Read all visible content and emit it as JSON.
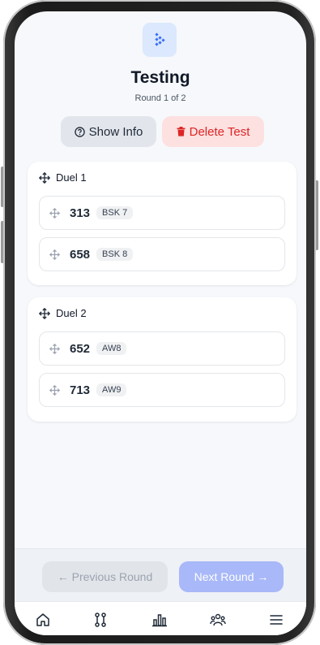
{
  "header": {
    "title": "Testing",
    "subtitle": "Round 1 of 2",
    "logo_icon": "app-logo-icon"
  },
  "actions": {
    "show_info": {
      "label": "Show Info",
      "icon": "help-circle-icon"
    },
    "delete_test": {
      "label": "Delete Test",
      "icon": "trash-icon"
    }
  },
  "duels": [
    {
      "title": "Duel 1",
      "entries": [
        {
          "number": "313",
          "tag": "BSK 7"
        },
        {
          "number": "658",
          "tag": "BSK 8"
        }
      ]
    },
    {
      "title": "Duel 2",
      "entries": [
        {
          "number": "652",
          "tag": "AW8"
        },
        {
          "number": "713",
          "tag": "AW9"
        }
      ]
    }
  ],
  "footer": {
    "previous_label": "← Previous Round",
    "next_label": "Next Round →"
  },
  "tabs": [
    "home-icon",
    "route-icon",
    "chart-icon",
    "people-icon",
    "menu-icon"
  ],
  "colors": {
    "accent": "#3b6ef5",
    "danger": "#dc2626",
    "danger_bg": "#fde0e0",
    "next_button": "#a8b8f8"
  }
}
